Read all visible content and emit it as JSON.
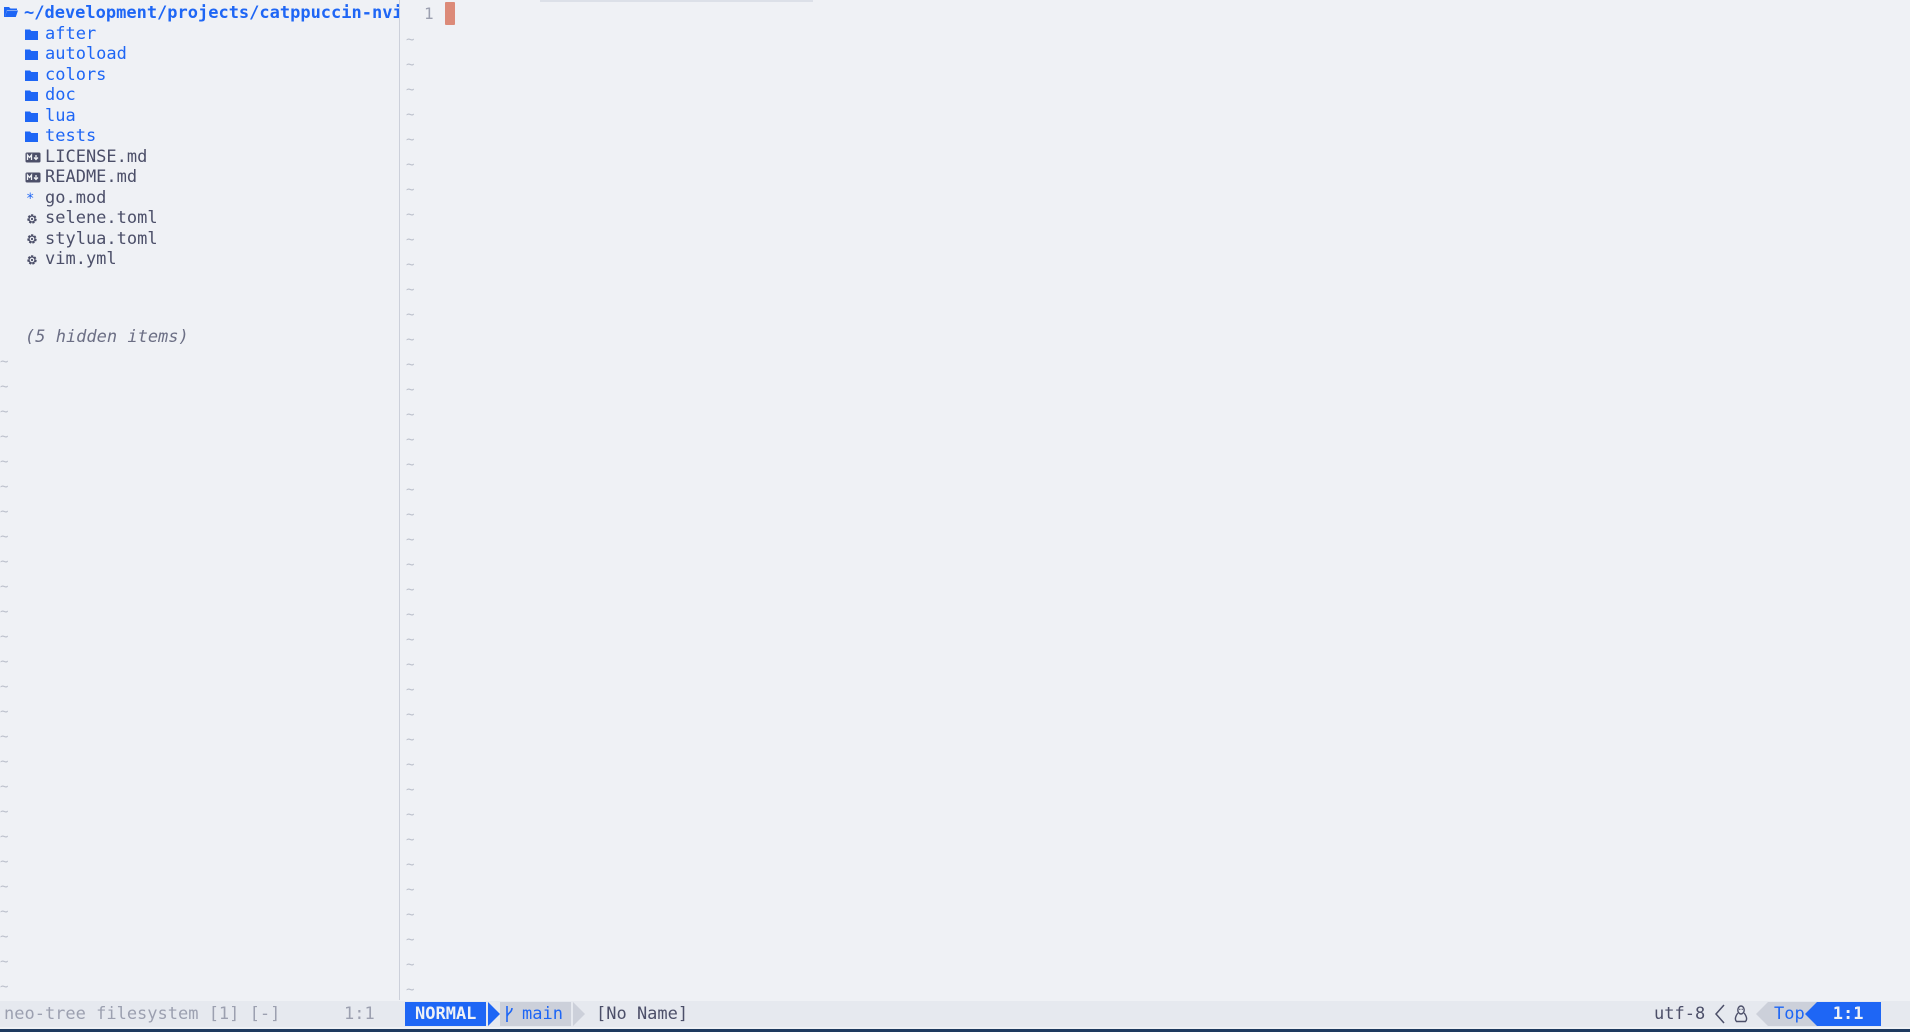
{
  "colors": {
    "background": "#eff1f5",
    "accent": "#1e66f5",
    "text": "#4c4f69",
    "muted": "#9ca0b0",
    "cursor": "#dc8a78"
  },
  "tree": {
    "root_icon": "folder-open-icon",
    "root_path": "~/development/projects/catppuccin-nvi",
    "items": [
      {
        "type": "dir",
        "icon": "folder-icon",
        "label": "after"
      },
      {
        "type": "dir",
        "icon": "folder-icon",
        "label": "autoload"
      },
      {
        "type": "dir",
        "icon": "folder-icon",
        "label": "colors"
      },
      {
        "type": "dir",
        "icon": "folder-icon",
        "label": "doc"
      },
      {
        "type": "dir",
        "icon": "folder-icon",
        "label": "lua"
      },
      {
        "type": "dir",
        "icon": "folder-icon",
        "label": "tests"
      },
      {
        "type": "file",
        "icon": "markdown-icon",
        "label": "LICENSE.md"
      },
      {
        "type": "file",
        "icon": "markdown-icon",
        "label": "README.md"
      },
      {
        "type": "file",
        "icon": "asterisk-icon",
        "label": "go.mod"
      },
      {
        "type": "file",
        "icon": "gear-icon",
        "label": "selene.toml"
      },
      {
        "type": "file",
        "icon": "gear-icon",
        "label": "stylua.toml"
      },
      {
        "type": "file",
        "icon": "gear-icon",
        "label": "vim.yml"
      }
    ],
    "hidden_note": "(5 hidden items)",
    "empty_marker": "~"
  },
  "editor": {
    "line_number": "1",
    "empty_marker": "~"
  },
  "statusline": {
    "tree_label": "neo-tree filesystem [1] [-]",
    "tree_position": "1:1",
    "mode": "NORMAL",
    "branch_icon": "git-branch-icon",
    "branch": "main",
    "filename": "[No Name]",
    "encoding": "utf-8",
    "separator_icon": "chevron-left-icon",
    "os_icon": "linux-tux-icon",
    "progress": "Top",
    "location": "1:1"
  }
}
